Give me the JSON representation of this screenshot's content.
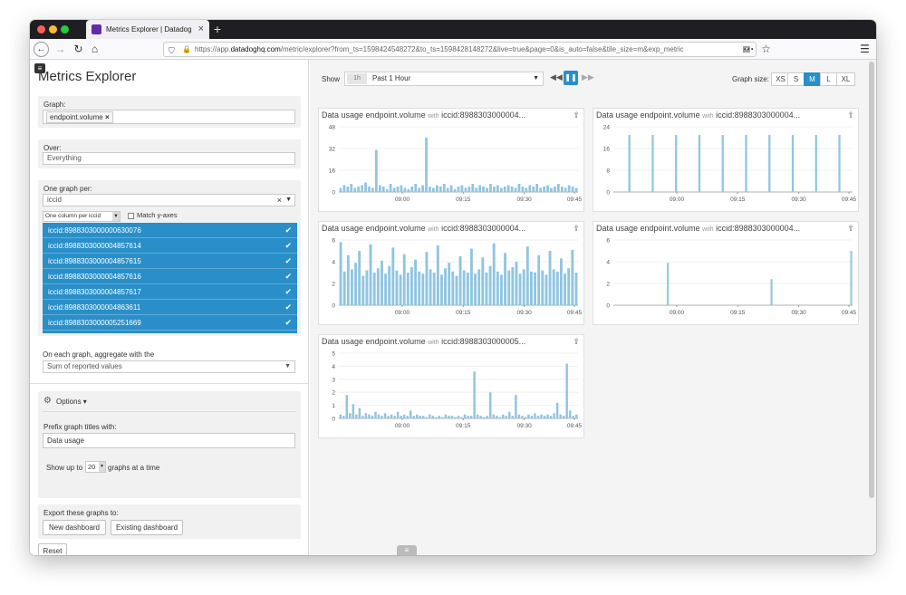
{
  "browser": {
    "tab_title": "Metrics Explorer | Datadog",
    "url_prefix": "https://app.",
    "url_domain": "datadoghq.com",
    "url_path": "/metric/explorer?from_ts=1598424548272&to_ts=1598428148272&live=true&page=0&is_auto=false&tile_size=m&exp_metric",
    "traffic_light_colors": [
      "#fe5f57",
      "#febc2e",
      "#28c840"
    ],
    "favicon_color": "#632ca6"
  },
  "sidebar": {
    "title": "Metrics Explorer",
    "graph_label": "Graph:",
    "metric_tag": "endpoint.volume",
    "over_label": "Over:",
    "over_value": "Everything",
    "one_graph_per_label": "One graph per:",
    "group_value": "iccid",
    "column_mode": "One column per iccid",
    "match_y_axes": "Match y-axes",
    "selected_items": [
      "iccid:8988303000000630076",
      "iccid:8988303000004857614",
      "iccid:8988303000004857615",
      "iccid:8988303000004857616",
      "iccid:8988303000004857617",
      "iccid:8988303000004863611",
      "iccid:8988303000005251669"
    ],
    "aggregate_label": "On each graph, aggregate with the",
    "aggregate_value": "Sum of reported values",
    "options_label": "Options",
    "prefix_label": "Prefix graph titles with:",
    "prefix_value": "Data usage",
    "show_up_to": "Show up to",
    "show_count": "20",
    "graphs_at_a_time": "graphs at a time",
    "export_label": "Export these graphs to:",
    "new_dashboard": "New dashboard",
    "existing_dashboard": "Existing dashboard",
    "reset": "Reset"
  },
  "toolbar": {
    "show_label": "Show",
    "time_badge": "1h",
    "time_value": "Past 1 Hour",
    "graph_size_label": "Graph size:",
    "sizes": [
      "XS",
      "S",
      "M",
      "L",
      "XL"
    ],
    "active_size": "M",
    "accent_color": "#2a8fc8"
  },
  "chart_data": [
    {
      "type": "bar",
      "title": "Data usage endpoint.volume",
      "with_text": "with",
      "tag": "iccid:8988303000004...",
      "x_ticks": [
        "09:00",
        "09:15",
        "09:30",
        "09:45"
      ],
      "y_ticks": [
        0,
        16,
        32,
        48
      ],
      "ylim": [
        0,
        48
      ],
      "values": [
        3,
        5,
        4,
        6,
        3,
        4,
        5,
        7,
        4,
        3,
        31,
        5,
        4,
        2,
        6,
        3,
        4,
        5,
        3,
        2,
        4,
        6,
        3,
        5,
        40,
        4,
        3,
        5,
        4,
        6,
        3,
        5,
        2,
        4,
        5,
        3,
        4,
        6,
        3,
        5,
        4,
        3,
        6,
        4,
        5,
        3,
        4,
        5,
        4,
        3,
        6,
        4,
        3,
        5,
        4,
        6,
        3,
        4,
        5,
        3,
        4,
        6,
        4,
        3,
        5,
        4,
        3
      ]
    },
    {
      "type": "bar",
      "title": "Data usage endpoint.volume",
      "with_text": "with",
      "tag": "iccid:8988303000004...",
      "x_ticks": [
        "09:00",
        "09:15",
        "09:30",
        "09:45"
      ],
      "y_ticks": [
        0,
        8,
        16,
        24
      ],
      "ylim": [
        0,
        24
      ],
      "values": [
        0,
        0,
        0,
        0,
        0,
        21,
        0,
        0,
        0,
        0,
        0,
        0,
        0,
        21,
        0,
        0,
        0,
        0,
        0,
        0,
        0,
        21,
        0,
        0,
        0,
        0,
        0,
        0,
        0,
        21,
        0,
        0,
        0,
        0,
        0,
        0,
        0,
        21,
        0,
        0,
        0,
        0,
        0,
        0,
        0,
        21,
        0,
        0,
        0,
        0,
        0,
        0,
        0,
        21,
        0,
        0,
        0,
        0,
        0,
        0,
        0,
        21,
        0,
        0,
        0,
        0,
        0,
        0,
        0,
        21,
        0,
        0,
        0,
        0,
        0,
        0,
        0,
        21,
        0,
        0,
        0,
        0
      ]
    },
    {
      "type": "bar",
      "title": "Data usage endpoint.volume",
      "with_text": "with",
      "tag": "iccid:8988303000004...",
      "x_ticks": [
        "09:00",
        "09:15",
        "09:30",
        "09:45"
      ],
      "y_ticks": [
        0,
        2,
        4,
        6
      ],
      "ylim": [
        0,
        6
      ],
      "values": [
        5.8,
        3.1,
        4.6,
        3.3,
        3.9,
        5.0,
        2.7,
        3.2,
        5.6,
        3.0,
        3.4,
        4.1,
        2.9,
        3.6,
        5.3,
        3.2,
        2.8,
        4.7,
        3.0,
        3.5,
        4.2,
        3.1,
        2.9,
        4.9,
        3.3,
        3.0,
        5.5,
        2.8,
        3.4,
        3.9,
        3.1,
        2.7,
        4.5,
        3.2,
        3.0,
        5.2,
        2.9,
        3.3,
        4.4,
        3.0,
        3.6,
        5.7,
        3.1,
        2.8,
        4.8,
        3.2,
        3.5,
        4.0,
        2.9,
        3.3,
        5.4,
        3.1,
        3.0,
        4.6,
        3.2,
        2.8,
        5.0,
        3.3,
        3.1,
        4.3,
        2.9,
        3.4,
        5.1,
        3.0
      ]
    },
    {
      "type": "bar",
      "title": "Data usage endpoint.volume",
      "with_text": "with",
      "tag": "iccid:8988303000004...",
      "x_ticks": [
        "09:00",
        "09:15",
        "09:30",
        "09:45"
      ],
      "y_ticks": [
        0,
        2,
        4,
        6
      ],
      "ylim": [
        0,
        6
      ],
      "values": [
        0,
        0,
        0,
        0,
        0,
        0,
        0,
        0,
        0,
        0,
        0,
        0,
        0,
        0,
        0,
        0,
        0,
        0,
        0,
        0,
        3.9,
        0,
        0,
        0,
        0,
        0,
        0,
        0,
        0,
        0,
        0,
        0,
        0,
        0,
        0,
        0,
        0,
        0,
        0,
        0,
        0,
        0,
        0,
        0,
        0,
        0,
        0,
        0,
        0,
        0,
        0,
        0,
        0,
        0,
        0,
        0,
        0,
        0,
        0,
        2.4,
        0,
        0,
        0,
        0,
        0,
        0,
        0,
        0,
        0,
        0,
        0,
        0,
        0,
        0,
        0,
        0,
        0,
        0,
        0,
        0,
        0,
        0,
        0,
        0,
        0,
        0,
        0,
        0,
        0,
        5.0
      ]
    },
    {
      "type": "bar",
      "title": "Data usage endpoint.volume",
      "with_text": "with",
      "tag": "iccid:8988303000005...",
      "x_ticks": [
        "09:00",
        "09:15",
        "09:30",
        "09:45"
      ],
      "y_ticks": [
        0,
        1,
        2,
        3,
        4,
        5
      ],
      "ylim": [
        0,
        5
      ],
      "values": [
        0.3,
        0.2,
        1.8,
        0.4,
        1.1,
        0.3,
        0.8,
        0.2,
        0.4,
        0.3,
        0.2,
        0.5,
        0.3,
        0.2,
        0.4,
        0.2,
        0.3,
        0.2,
        0.5,
        0.2,
        0.3,
        0.2,
        0.6,
        0.2,
        0.3,
        0.2,
        0.2,
        0.1,
        0.3,
        0.2,
        0.1,
        0.2,
        0.1,
        0.3,
        0.2,
        0.2,
        0.1,
        0.2,
        0.1,
        0.3,
        0.2,
        0.2,
        3.6,
        0.3,
        0.2,
        0.1,
        0.2,
        2.0,
        0.3,
        0.2,
        0.1,
        0.3,
        0.2,
        0.5,
        0.2,
        1.8,
        0.3,
        0.2,
        0.1,
        0.3,
        0.2,
        0.4,
        0.2,
        0.3,
        0.2,
        0.3,
        0.2,
        0.4,
        1.2,
        0.3,
        0.2,
        4.2,
        0.6,
        0.2,
        0.3
      ]
    }
  ]
}
